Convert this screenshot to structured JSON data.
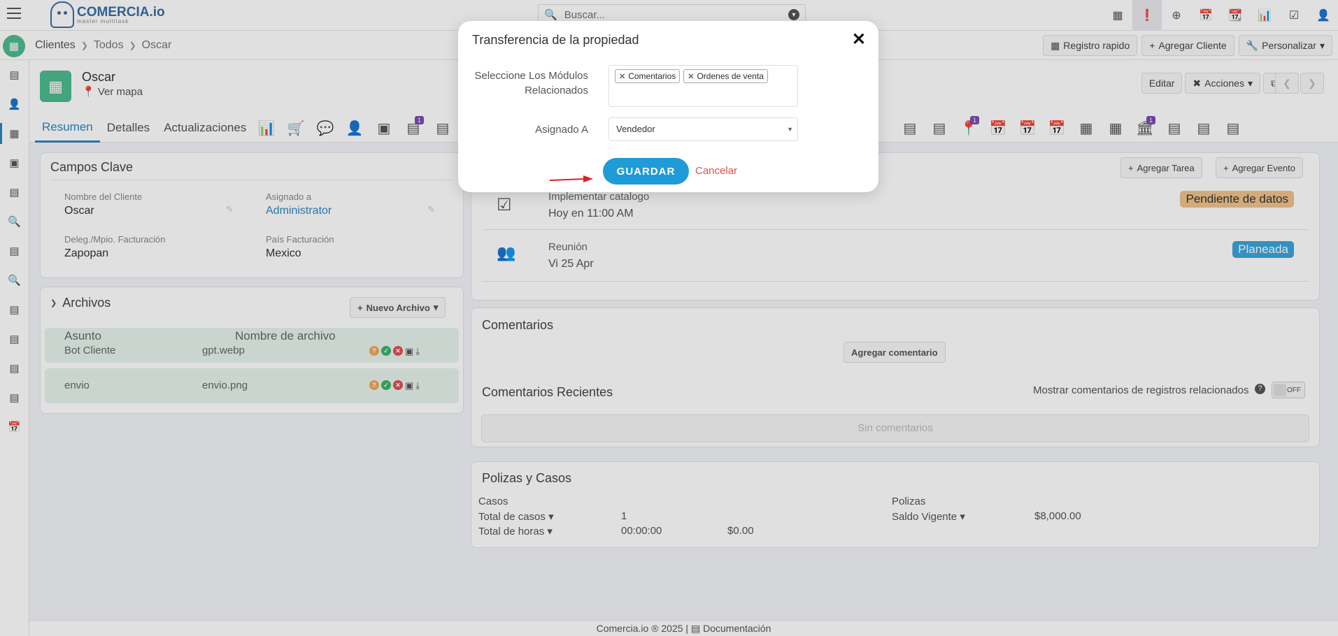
{
  "topbar": {
    "logo_name": "COMERCIA.io",
    "logo_sub": "master multitask",
    "search_placeholder": "Buscar..."
  },
  "breadcrumb": {
    "items": [
      "Clientes",
      "Todos",
      "Oscar"
    ],
    "buttons": [
      "Registro rapido",
      "Agregar Cliente",
      "Personalizar"
    ]
  },
  "record": {
    "name": "Oscar",
    "map_link": "Ver mapa",
    "actions": [
      "Editar",
      "Acciones"
    ],
    "tabs": [
      "Resumen",
      "Detalles",
      "Actualizaciones"
    ],
    "tab_badges": [
      "1",
      "1",
      "1"
    ]
  },
  "key_fields": {
    "title": "Campos Clave",
    "fields": [
      {
        "label": "Nombre del Cliente",
        "value": "Oscar"
      },
      {
        "label": "Asignado a",
        "value": "Administrator"
      },
      {
        "label": "Deleg./Mpio. Facturación",
        "value": "Zapopan"
      },
      {
        "label": "País Facturación",
        "value": "Mexico"
      }
    ]
  },
  "files": {
    "title": "Archivos",
    "new_button": "Nuevo Archivo",
    "columns": [
      "Asunto",
      "Nombre de archivo"
    ],
    "rows": [
      {
        "subject": "Bot Cliente",
        "filename": "gpt.webp"
      },
      {
        "subject": "envio",
        "filename": "envio.png"
      }
    ]
  },
  "activities": {
    "add_task": "Agregar Tarea",
    "add_event": "Agregar Evento",
    "items": [
      {
        "title": "Implementar catalogo",
        "when": "Hoy en 11:00 AM",
        "status": "Pendiente de datos",
        "status_color": "#f0c38b"
      },
      {
        "title": "Reunión",
        "when": "Vi 25 Apr",
        "status": "Planeada",
        "status_color": "#3aa6dc"
      }
    ]
  },
  "comments": {
    "title": "Comentarios",
    "add_button": "Agregar comentario",
    "recent_title": "Comentarios Recientes",
    "related_label": "Mostrar comentarios de registros relacionados",
    "toggle_label": "OFF",
    "empty": "Sin comentarios"
  },
  "policies": {
    "title": "Polizas y Casos",
    "cases_header": "Casos",
    "total_cases_label": "Total de casos",
    "total_cases_value": "1",
    "total_hours_label": "Total de horas",
    "total_hours_value": "00:00:00",
    "total_hours_amount": "$0.00",
    "policies_header": "Polizas",
    "balance_label": "Saldo Vigente",
    "balance_value": "$8,000.00"
  },
  "footer": {
    "copyright": "Comercia.io ® 2025",
    "docs": "Documentación"
  },
  "modal": {
    "title": "Transferencia de la propiedad",
    "modules_label_1": "Seleccione Los Módulos",
    "modules_label_2": "Relacionados",
    "modules": [
      "Comentarios",
      "Ordenes de venta"
    ],
    "assigned_label": "Asignado A",
    "assigned_value": "Vendedor",
    "save": "GUARDAR",
    "cancel": "Cancelar"
  },
  "colors": {
    "accent": "#2e86c1",
    "brand_green": "#4dbb90",
    "save_button": "#1f9bd8",
    "cancel_text": "#e05050",
    "badge": "#7b4bb3"
  }
}
